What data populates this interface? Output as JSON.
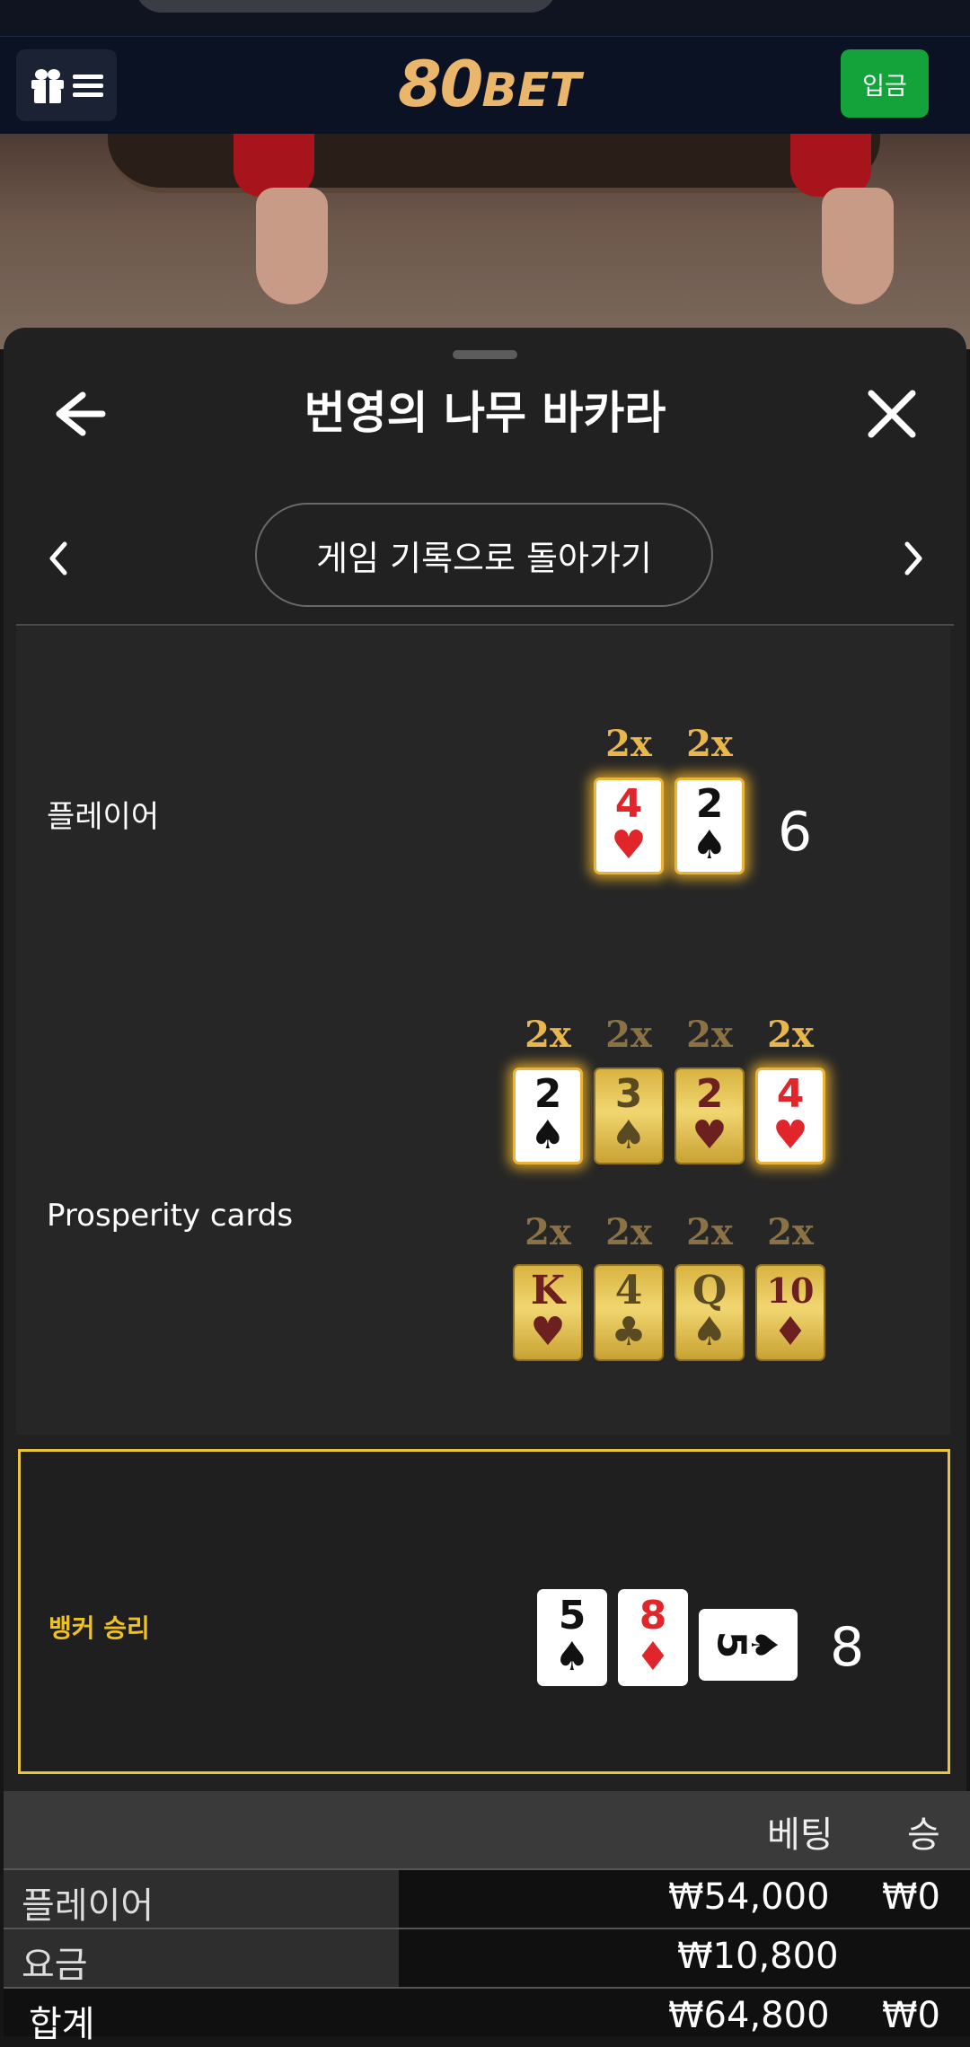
{
  "header": {
    "logo_main": "80",
    "logo_sub": "BET",
    "deposit_label": "입금"
  },
  "sheet": {
    "title": "번영의 나무 바카라",
    "history_button": "게임 기록으로 돌아가기"
  },
  "player": {
    "label": "플레이어",
    "multipliers": [
      "2x",
      "2x"
    ],
    "cards": [
      {
        "rank": "4",
        "suit": "♥"
      },
      {
        "rank": "2",
        "suit": "♠"
      }
    ],
    "total": "6"
  },
  "prosperity": {
    "label": "Prosperity cards",
    "row1_multipliers": [
      "2x",
      "2x",
      "2x",
      "2x"
    ],
    "row1_cards": [
      {
        "rank": "2",
        "suit": "♠"
      },
      {
        "rank": "3",
        "suit": "♠"
      },
      {
        "rank": "2",
        "suit": "♥"
      },
      {
        "rank": "4",
        "suit": "♥"
      }
    ],
    "row2_multipliers": [
      "2x",
      "2x",
      "2x",
      "2x"
    ],
    "row2_cards": [
      {
        "rank": "K",
        "suit": "♥"
      },
      {
        "rank": "4",
        "suit": "♣"
      },
      {
        "rank": "Q",
        "suit": "♠"
      },
      {
        "rank": "10",
        "suit": "♦"
      }
    ]
  },
  "banker": {
    "label": "뱅커 승리",
    "cards": [
      {
        "rank": "5",
        "suit": "♠"
      },
      {
        "rank": "8",
        "suit": "♦"
      },
      {
        "rank": "5",
        "suit": "♠"
      }
    ],
    "total": "8"
  },
  "bets_table": {
    "col_bet": "베팅",
    "col_win": "승",
    "rows": [
      {
        "label": "플레이어",
        "bet": "₩54,000",
        "win": "₩0"
      },
      {
        "label": "요금",
        "bet": "₩10,800",
        "win": ""
      },
      {
        "label": "합계",
        "bet": "₩64,800",
        "win": "₩0"
      }
    ]
  },
  "colors": {
    "accent_gold": "#e8b64c",
    "banker_yellow": "#f0c21f",
    "deposit_green": "#13a33a"
  }
}
